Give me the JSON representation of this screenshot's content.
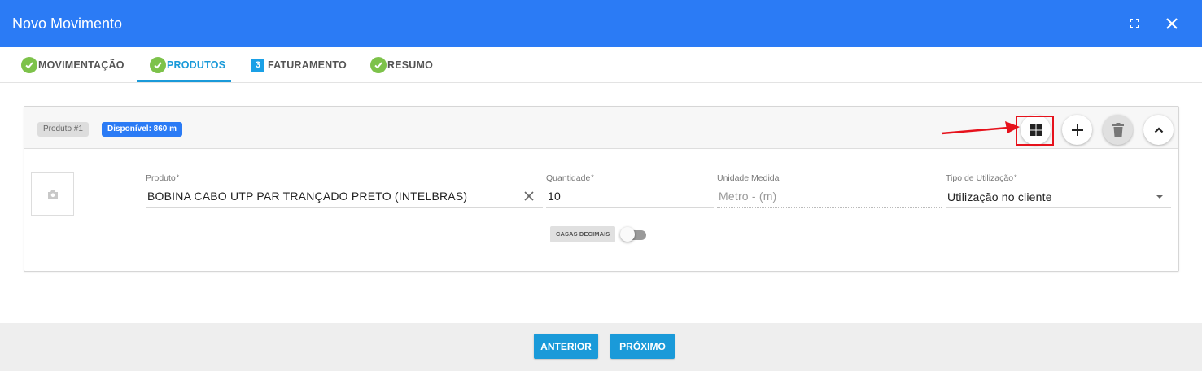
{
  "header": {
    "title": "Novo Movimento",
    "color": "#2b7bf5"
  },
  "tabs": [
    {
      "label": "MOVIMENTAÇÃO",
      "status": "check-icon",
      "active": false
    },
    {
      "label": "PRODUTOS",
      "status": "check-icon",
      "active": true
    },
    {
      "label": "FATURAMENTO",
      "step": "3",
      "active": false
    },
    {
      "label": "RESUMO",
      "status": "check-icon",
      "active": false
    }
  ],
  "product": {
    "badge": "Produto #1",
    "available": "Disponível: 860 m",
    "fields": {
      "produto": {
        "label": "Produto",
        "required": "*",
        "value": "BOBINA CABO UTP PAR TRANÇADO PRETO (INTELBRAS)"
      },
      "quantidade": {
        "label": "Quantidade",
        "required": "*",
        "value": "10"
      },
      "unidade": {
        "label": "Unidade Medida",
        "value": "Metro - (m)"
      },
      "tipo": {
        "label": "Tipo de Utilização",
        "required": "*",
        "value": "Utilização no cliente"
      }
    },
    "casas_decimais": {
      "label": "CASAS DECIMAIS",
      "enabled": false
    }
  },
  "footer": {
    "prev_label": "ANTERIOR",
    "next_label": "PRÓXIMO"
  },
  "colors": {
    "accent": "#1a9ad9",
    "success": "#7dc24a",
    "highlight": "#e6121c"
  }
}
